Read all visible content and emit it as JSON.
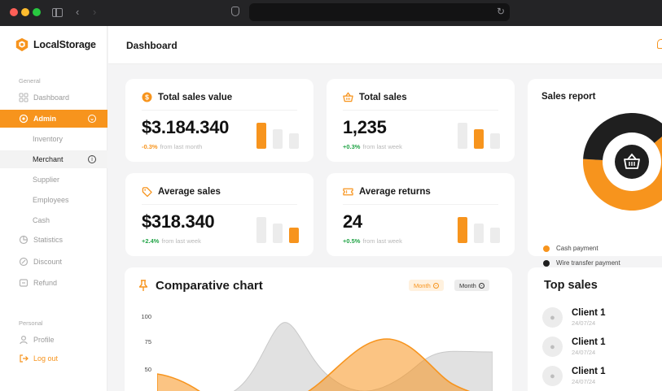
{
  "browser": {
    "url": ""
  },
  "sidebar": {
    "brand": "LocalStorage",
    "general_label": "General",
    "personal_label": "Personal",
    "items": [
      {
        "label": "Dashboard",
        "icon": "grid-icon"
      },
      {
        "label": "Admin",
        "icon": "admin-icon",
        "state": "active"
      },
      {
        "label": "Inventory"
      },
      {
        "label": "Merchant",
        "state": "selected"
      },
      {
        "label": "Supplier"
      },
      {
        "label": "Employees"
      },
      {
        "label": "Cash"
      },
      {
        "label": "Statistics",
        "icon": "pie-icon"
      },
      {
        "label": "Discount",
        "icon": "discount-icon"
      },
      {
        "label": "Refund",
        "icon": "refund-icon"
      },
      {
        "label": "Profile",
        "icon": "user-icon"
      },
      {
        "label": "Log out",
        "icon": "logout-icon"
      }
    ]
  },
  "header": {
    "title": "Dashboard"
  },
  "stats": {
    "total_sales_value": {
      "title": "Total sales value",
      "value": "$3.184.340",
      "change": "-0.3%",
      "note": "from last month",
      "bars": [
        0.95,
        0.72,
        0.55
      ],
      "highlight": 0
    },
    "total_sales": {
      "title": "Total sales",
      "value": "1,235",
      "change": "+0.3%",
      "note": "from last week",
      "bars": [
        0.95,
        0.72,
        0.55
      ],
      "highlight": 1
    },
    "average_sales": {
      "title": "Average sales",
      "value": "$318.340",
      "change": "+2.4%",
      "note": "from last week",
      "bars": [
        0.95,
        0.72,
        0.55
      ],
      "highlight": 2
    },
    "average_returns": {
      "title": "Average returns",
      "value": "24",
      "change": "+0.5%",
      "note": "from last week",
      "bars": [
        0.95,
        0.72,
        0.55
      ],
      "highlight": 0
    }
  },
  "sales_report": {
    "title": "Sales report",
    "legend": [
      {
        "label": "Cash payment",
        "color": "#f7941d",
        "share": 0.62
      },
      {
        "label": "Wire transfer payment",
        "color": "#1f1f1f",
        "share": 0.38
      }
    ]
  },
  "comparative_chart": {
    "title": "Comparative chart",
    "filters": [
      {
        "label": "Month",
        "style": "active"
      },
      {
        "label": "Month",
        "style": "default"
      }
    ],
    "ticks": [
      "100",
      "75",
      "50"
    ]
  },
  "top_sales": {
    "title": "Top sales",
    "clients": [
      {
        "name": "Client 1",
        "date": "24/07/24"
      },
      {
        "name": "Client 1",
        "date": "24/07/24"
      },
      {
        "name": "Client 1",
        "date": "24/07/24"
      }
    ]
  },
  "colors": {
    "accent": "#f7941d",
    "dark": "#1f1f1f",
    "positive": "#22a447"
  }
}
